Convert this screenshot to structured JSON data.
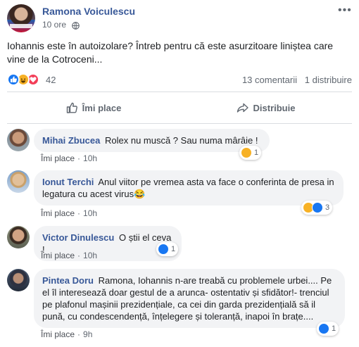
{
  "post": {
    "author": "Ramona Voiculescu",
    "time": "10 ore",
    "text": "Iohannis este în autoizolare? Întreb pentru că este asurzitoare liniștea care vine de la Cotroceni...",
    "reactions_count": "42",
    "comments_count": "13 comentarii",
    "shares_count": "1 distribuire",
    "reaction_types": [
      "like-icon",
      "haha-icon",
      "love-icon"
    ]
  },
  "actions": {
    "like_label": "Îmi place",
    "share_label": "Distribuie"
  },
  "comments": [
    {
      "author": "Mihai Zbucea",
      "text": "Rolex nu muscă ? Sau numa mârâie !",
      "like_label": "Îmi place",
      "time": "10h",
      "reactions_count": "1",
      "reaction_types": [
        "haha-icon"
      ]
    },
    {
      "author": "Ionut Terchi",
      "text": "Anul viitor pe vremea asta va face o conferinta de presa in legatura cu acest virus😂",
      "like_label": "Îmi place",
      "time": "10h",
      "reactions_count": "3",
      "reaction_types": [
        "haha-icon",
        "like-icon"
      ]
    },
    {
      "author": "Victor Dinulescu",
      "text": "O știi el ceva !",
      "like_label": "Îmi place",
      "time": "10h",
      "reactions_count": "1",
      "reaction_types": [
        "like-icon"
      ]
    },
    {
      "author": "Pintea Doru",
      "text": "Ramona, Iohannis n-are treabă cu problemele urbei.... Pe el îl interesează doar gestul de a arunca- ostentativ și sfidător!- trenciul pe plafonul mașinii prezidențiale, ca cei din garda prezidențială să il pună, cu condescendență, înțelegere și toleranță, inapoi în brațe....",
      "like_label": "Îmi place",
      "time": "9h",
      "reactions_count": "1",
      "reaction_types": [
        "like-icon"
      ]
    }
  ],
  "colors": {
    "link_blue": "#385898",
    "like_blue": "#1877f2",
    "haha_yellow": "#f7b125",
    "love_red": "#f33e58",
    "bubble_gray": "#f2f3f5"
  }
}
